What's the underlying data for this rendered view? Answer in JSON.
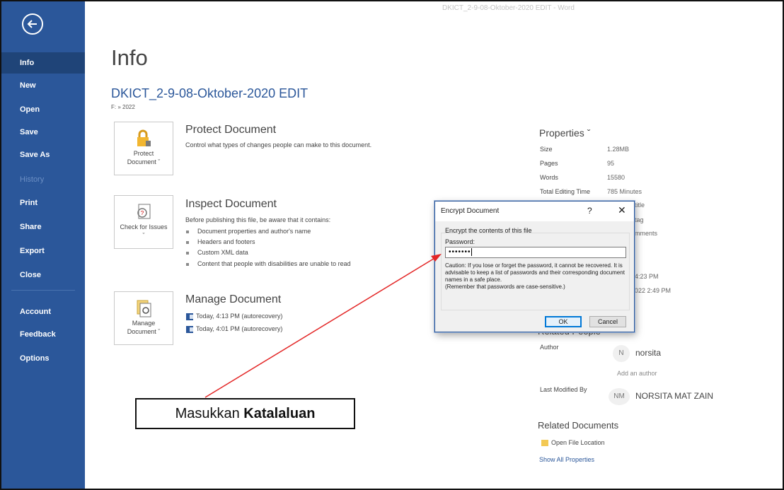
{
  "window": {
    "title": "DKICT_2-9-08-Oktober-2020 EDIT  -  Word"
  },
  "sidebar": {
    "items": [
      {
        "label": "Info",
        "active": true
      },
      {
        "label": "New"
      },
      {
        "label": "Open"
      },
      {
        "label": "Save"
      },
      {
        "label": "Save As"
      },
      {
        "label": "History",
        "disabled": true
      },
      {
        "label": "Print"
      },
      {
        "label": "Share"
      },
      {
        "label": "Export"
      },
      {
        "label": "Close"
      },
      {
        "label": "Account"
      },
      {
        "label": "Feedback"
      },
      {
        "label": "Options"
      }
    ]
  },
  "main": {
    "title": "Info",
    "doc_name": "DKICT_2-9-08-Oktober-2020 EDIT",
    "doc_path": "F: » 2022",
    "protect": {
      "tile_label": "Protect Document ˇ",
      "heading": "Protect Document",
      "description": "Control what types of changes people can make to this document."
    },
    "inspect": {
      "tile_label": "Check for Issues ˇ",
      "heading": "Inspect Document",
      "description": "Before publishing this file, be aware that it contains:",
      "bullets": [
        "Document properties and author's name",
        "Headers and footers",
        "Custom XML data",
        "Content that people with disabilities are unable to read"
      ]
    },
    "manage": {
      "tile_label": "Manage Document ˇ",
      "heading": "Manage Document",
      "versions": [
        "Today, 4:13 PM (autorecovery)",
        "Today, 4:01 PM (autorecovery)"
      ]
    }
  },
  "properties": {
    "heading": "Properties ˇ",
    "rows": [
      {
        "key": "Size",
        "value": "1.28MB"
      },
      {
        "key": "Pages",
        "value": "95"
      },
      {
        "key": "Words",
        "value": "15580"
      },
      {
        "key": "Total Editing Time",
        "value": "785 Minutes"
      }
    ],
    "partial": [
      "title",
      "tag",
      "mments",
      "4:23 PM",
      "022 2:49 PM"
    ],
    "related_people_heading": "Related People",
    "author_label": "Author",
    "author_initial": "N",
    "author_name": "norsita",
    "add_author": "Add an author",
    "last_modified_label": "Last Modified By",
    "last_modified_initials": "NM",
    "last_modified_name": "NORSITA MAT ZAIN",
    "related_docs_heading": "Related Documents",
    "open_file_location": "Open File Location",
    "show_all": "Show All Properties"
  },
  "dialog": {
    "title": "Encrypt Document",
    "help": "?",
    "close": "✕",
    "heading": "Encrypt the contents of this file",
    "password_label": "Password:",
    "password_value": "•••••••",
    "caution": "Caution: If you lose or forget the password, it cannot be recovered. It is advisable to keep a list of passwords and their corresponding document names in a safe place.",
    "caution_note": "(Remember that passwords are case-sensitive.)",
    "ok": "OK",
    "cancel": "Cancel"
  },
  "annotation": {
    "text_normal": "Masukkan ",
    "text_bold": "Katalaluan",
    "color": "#e32626"
  }
}
